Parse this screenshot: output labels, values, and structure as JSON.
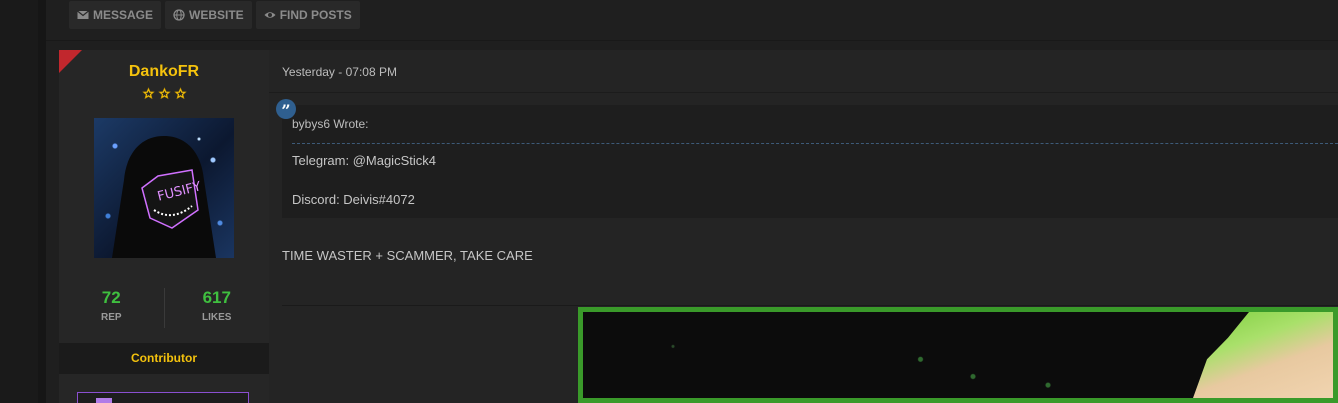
{
  "actions": [
    {
      "label": "MESSAGE",
      "icon": "envelope-icon"
    },
    {
      "label": "WEBSITE",
      "icon": "globe-icon"
    },
    {
      "label": "FIND POSTS",
      "icon": "eye-icon"
    }
  ],
  "author": {
    "username": "DankoFR",
    "star_count": 3,
    "stats": {
      "rep_value": "72",
      "rep_label": "REP",
      "likes_value": "617",
      "likes_label": "LIKES"
    },
    "role": "Contributor",
    "avatar_text": "FUSIFY"
  },
  "post": {
    "date": "Yesterday - 07:08 PM",
    "quote": {
      "author_line": "bybys6 Wrote:",
      "lines": [
        "Telegram: @MagicStick4",
        "Discord: Deivis#4072"
      ]
    },
    "message": "TIME WASTER + SCAMMER, TAKE CARE"
  },
  "colors": {
    "username": "#f4c20d",
    "stat_value": "#3fbf3f",
    "corner_flag": "#c1272d",
    "image_border": "#3a9a2a"
  }
}
